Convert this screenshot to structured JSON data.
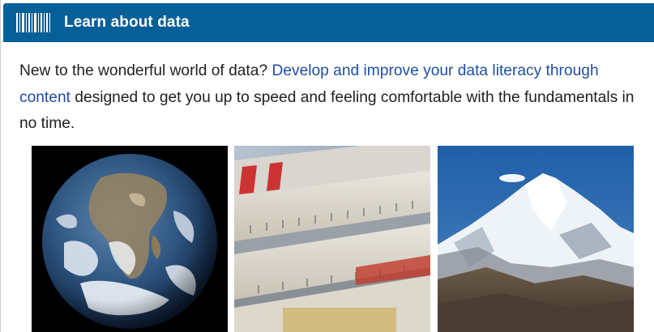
{
  "header": {
    "icon": "barcode-icon",
    "title": "Learn about data",
    "background_color": "#075f97"
  },
  "intro": {
    "text_before": "New to the wonderful world of data? ",
    "link_text": "Develop and improve your data literacy through content",
    "text_after": " designed to get you up to speed and feeling comfortable with the fundamentals in no time.",
    "link_color": "#1f4ea2"
  },
  "images": [
    {
      "name": "earth-image",
      "depicts": "planet Earth from space"
    },
    {
      "name": "folding-ruler-image",
      "depicts": "folding ruler close-up"
    },
    {
      "name": "mountain-image",
      "depicts": "snowy mountain peak"
    }
  ]
}
